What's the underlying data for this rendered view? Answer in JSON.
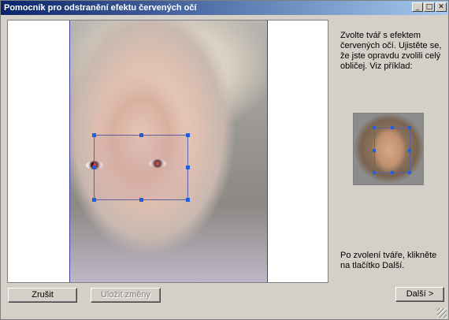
{
  "window": {
    "title": "Pomocník pro odstranění efektu červených očí",
    "controls": {
      "minimize": "_",
      "maximize": "□",
      "close": "✕"
    }
  },
  "instructions": {
    "select_face": "Zvolte tvář s efektem červených očí. Ujistěte se, že jste opravdu zvolili celý obličej. Viz příklad:",
    "after_select": "Po zvolení tváře, klikněte na tlačítko Další."
  },
  "buttons": {
    "cancel": "Zrušit",
    "save": "Uložit změny",
    "next": "Další >"
  },
  "colors": {
    "titlebar_start": "#0a246a",
    "titlebar_end": "#a6caf0",
    "selection_handle": "#2060e0",
    "window_bg": "#d4d0c8"
  }
}
